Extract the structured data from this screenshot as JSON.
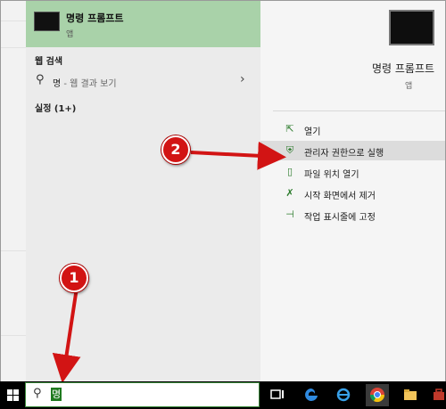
{
  "best_match": {
    "title": "명령 프롬프트",
    "subtitle": "앱"
  },
  "web_section": {
    "header": "웹 검색",
    "query": "명",
    "hint": " - 웹 결과 보기"
  },
  "settings_section": {
    "header": "실정 (1+)"
  },
  "preview": {
    "title": "명령 프롬프트",
    "subtitle": "앱"
  },
  "actions": [
    {
      "label": "열기",
      "icon": "open-icon"
    },
    {
      "label": "관리자 권한으로 실행",
      "icon": "admin-shield-icon"
    },
    {
      "label": "파일 위치 열기",
      "icon": "folder-icon"
    },
    {
      "label": "시작 화면에서 제거",
      "icon": "unpin-start-icon"
    },
    {
      "label": "작업 표시줄에 고정",
      "icon": "pin-taskbar-icon"
    }
  ],
  "annotations": {
    "step1": "1",
    "step2": "2"
  },
  "taskbar": {
    "search_value": "명",
    "icons": [
      "task-view-icon",
      "edge-icon",
      "ie-icon",
      "chrome-icon",
      "file-explorer-icon",
      "toolbox-icon"
    ]
  },
  "colors": {
    "selected_result": "#a9d2a9",
    "annotation_red": "#d21414",
    "taskbar": "#000000"
  }
}
